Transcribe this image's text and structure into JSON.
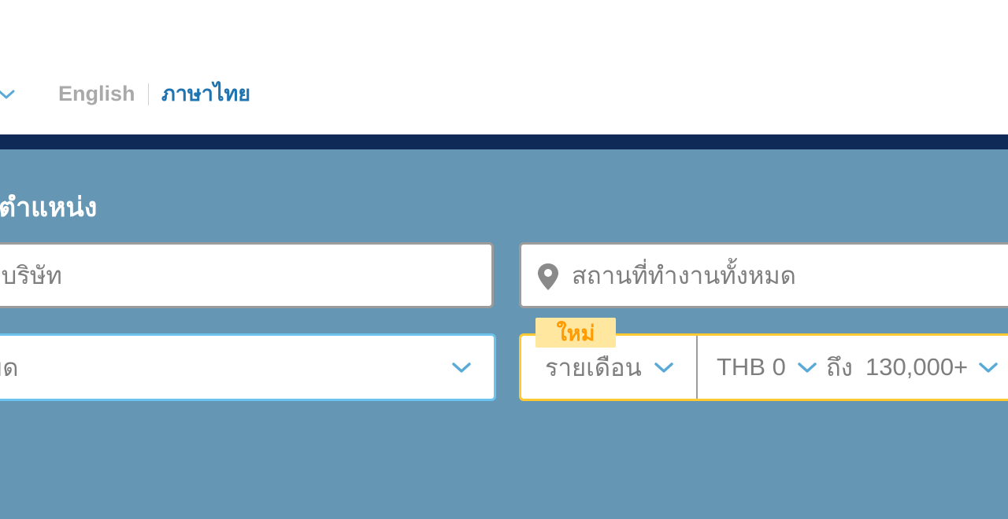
{
  "header": {
    "languages": [
      {
        "label": "English",
        "active": false
      },
      {
        "label": "ภาษาไทย",
        "active": true
      }
    ]
  },
  "search": {
    "title": "ตำแหน่ง",
    "keyword": {
      "placeholder": "อบริษัท"
    },
    "location": {
      "placeholder": "สถานที่ทำงานทั้งหมด"
    },
    "classification": {
      "value": "มด"
    },
    "salary": {
      "badge": "ใหม่",
      "type": "รายเดือน",
      "min": "THB 0",
      "to": "ถึง",
      "max": "130,000+"
    }
  },
  "colors": {
    "navbar": "#0f2a57",
    "panel": "#6596b3",
    "accent_blue": "#1e73b0",
    "focus_border": "#6cc3ee",
    "salary_border": "#ffc930",
    "badge_bg": "#ffe7a0",
    "badge_text": "#ff9b00"
  }
}
